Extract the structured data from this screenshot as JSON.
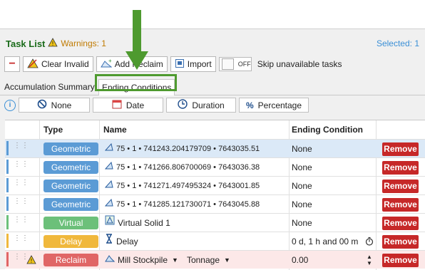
{
  "header": {
    "title": "Task List",
    "warnings": "Warnings: 1",
    "selected": "Selected: 1"
  },
  "toolbar": {
    "clear_invalid": "Clear Invalid",
    "add_reclaim": "Add Reclaim",
    "import": "Import",
    "toggle_state": "OFF",
    "skip_label": "Skip unavailable tasks"
  },
  "tabs": {
    "accumulation": "Accumulation Summary",
    "ending": "Ending Conditions"
  },
  "filters": {
    "none": "None",
    "date": "Date",
    "duration": "Duration",
    "percentage": "Percentage"
  },
  "columns": {
    "type": "Type",
    "name": "Name",
    "ending": "Ending Condition"
  },
  "rows": [
    {
      "type": "Geometric",
      "name": "75 • 1 • 741243.204179709 • 7643035.51",
      "cond": "None",
      "remove": "Remove",
      "color": "#5b9bd5",
      "stripe": "#5b9bd5"
    },
    {
      "type": "Geometric",
      "name": "75 • 1 • 741266.806700069 • 7643036.38",
      "cond": "None",
      "remove": "Remove",
      "color": "#5b9bd5",
      "stripe": "#5b9bd5"
    },
    {
      "type": "Geometric",
      "name": "75 • 1 • 741271.497495324 • 7643001.85",
      "cond": "None",
      "remove": "Remove",
      "color": "#5b9bd5",
      "stripe": "#5b9bd5"
    },
    {
      "type": "Geometric",
      "name": "75 • 1 • 741285.121730071 • 7643045.88",
      "cond": "None",
      "remove": "Remove",
      "color": "#5b9bd5",
      "stripe": "#5b9bd5"
    },
    {
      "type": "Virtual",
      "name": "Virtual Solid 1",
      "cond": "None",
      "remove": "Remove",
      "color": "#6cc07a",
      "stripe": "#6cc07a"
    },
    {
      "type": "Delay",
      "name": "Delay",
      "cond": "0 d, 1 h and 00 m",
      "remove": "Remove",
      "color": "#f0b83c",
      "stripe": "#f0b83c"
    },
    {
      "type": "Reclaim",
      "name": "Mill Stockpile",
      "cond": "0.00",
      "remove": "Remove",
      "color": "#e06666",
      "stripe": "#e06666",
      "extra": "Tonnage"
    }
  ]
}
